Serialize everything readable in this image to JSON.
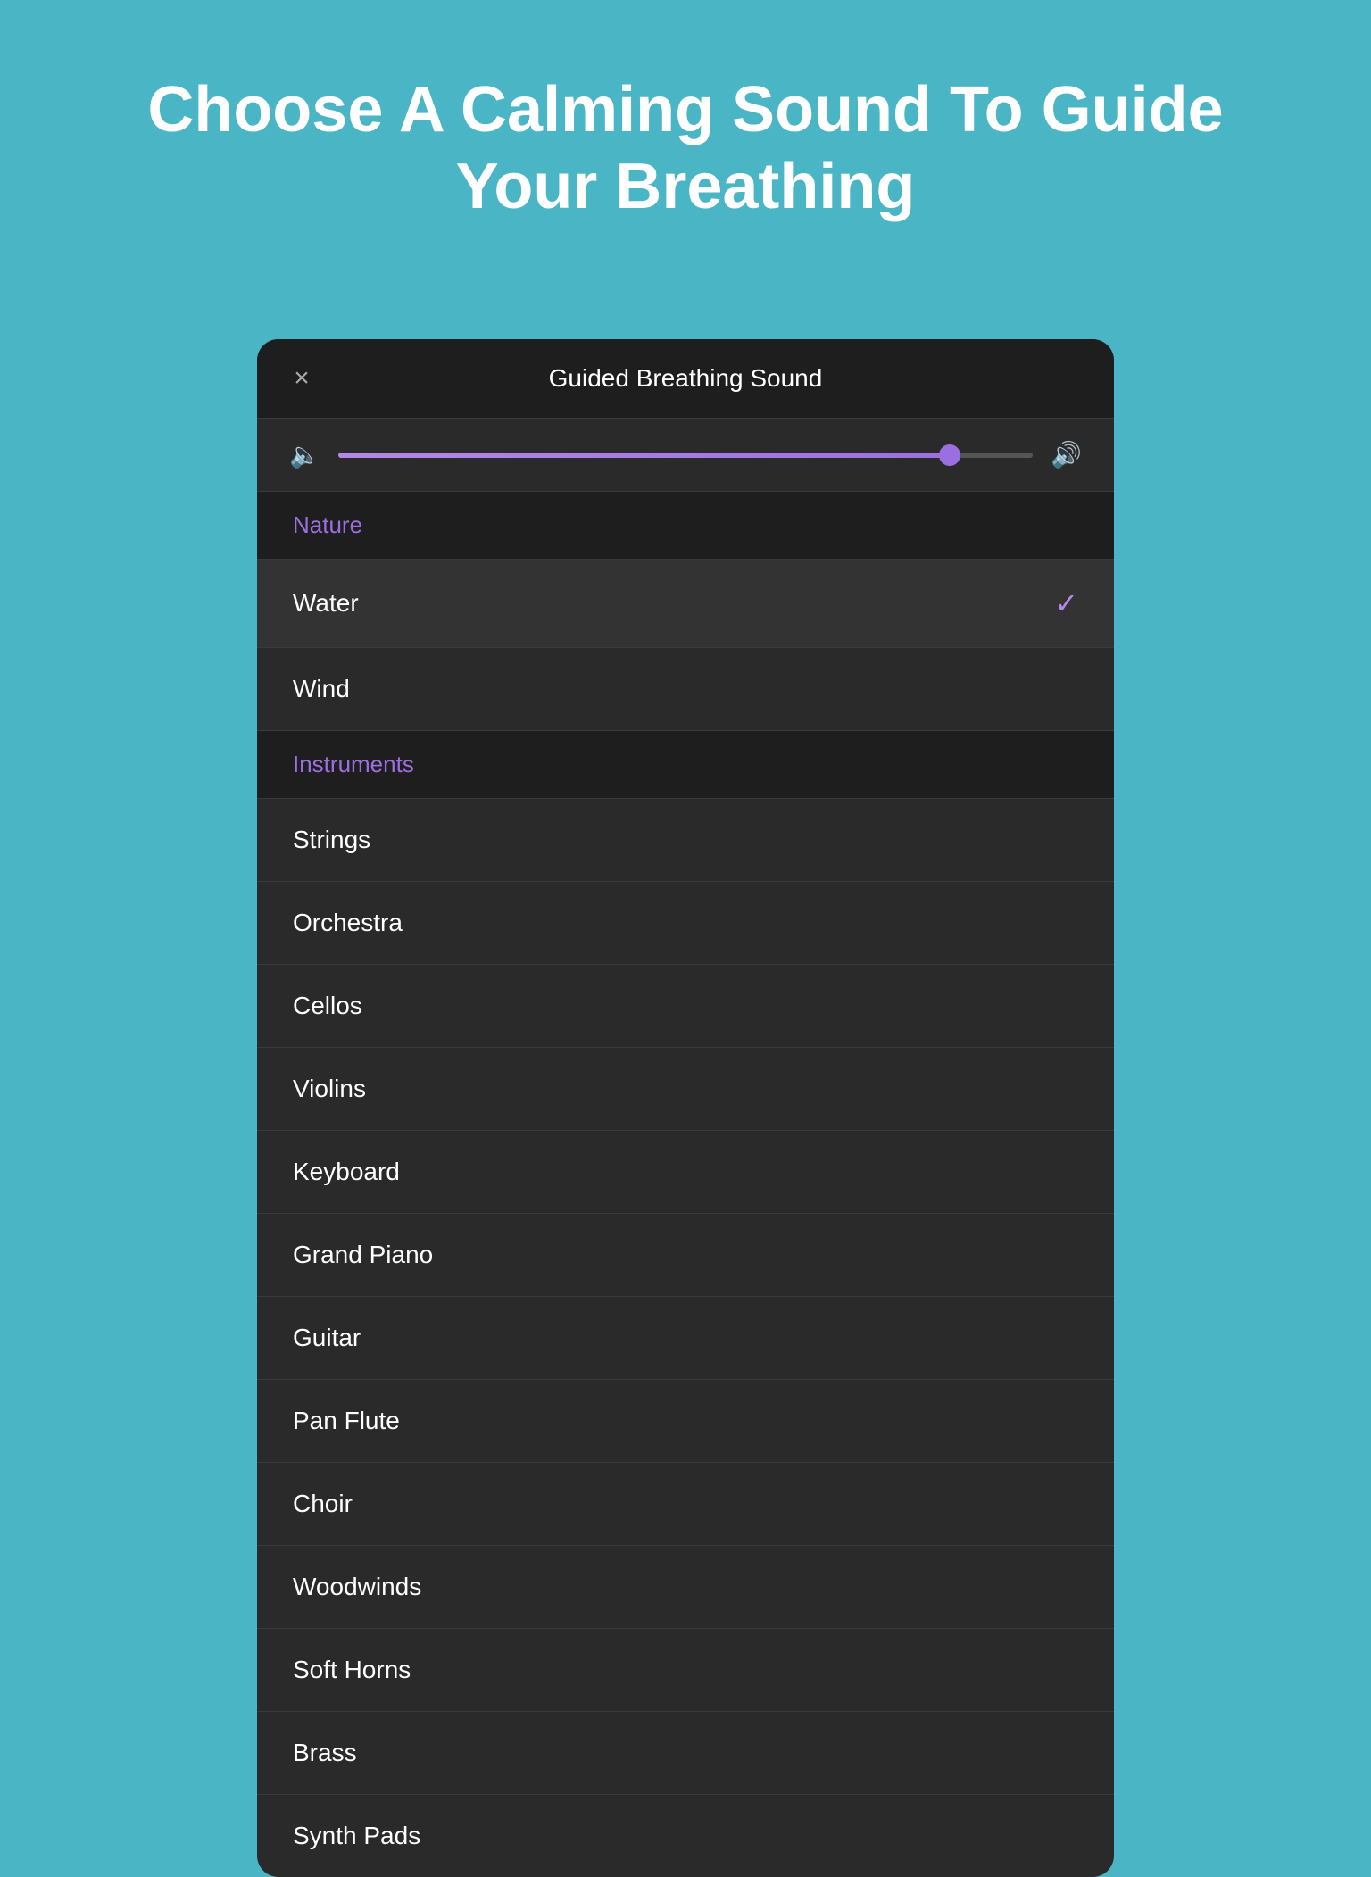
{
  "page": {
    "title": "Choose A Calming Sound To Guide Your Breathing",
    "background_color": "#4ab5c4"
  },
  "modal": {
    "title": "Guided Breathing Sound",
    "close_label": "×",
    "volume": {
      "min_icon": "🔈",
      "max_icon": "🔊",
      "value": 88,
      "fill_percent": "88%"
    },
    "sound_list": [
      {
        "id": "nature",
        "label": "Nature",
        "type": "category",
        "selected": false
      },
      {
        "id": "water",
        "label": "Water",
        "type": "item",
        "selected": true
      },
      {
        "id": "wind",
        "label": "Wind",
        "type": "item",
        "selected": false
      },
      {
        "id": "instruments",
        "label": "Instruments",
        "type": "category",
        "selected": false
      },
      {
        "id": "strings",
        "label": "Strings",
        "type": "item",
        "selected": false
      },
      {
        "id": "orchestra",
        "label": "Orchestra",
        "type": "item",
        "selected": false
      },
      {
        "id": "cellos",
        "label": "Cellos",
        "type": "item",
        "selected": false
      },
      {
        "id": "violins",
        "label": "Violins",
        "type": "item",
        "selected": false
      },
      {
        "id": "keyboard",
        "label": "Keyboard",
        "type": "item",
        "selected": false
      },
      {
        "id": "grand-piano",
        "label": "Grand Piano",
        "type": "item",
        "selected": false
      },
      {
        "id": "guitar",
        "label": "Guitar",
        "type": "item",
        "selected": false
      },
      {
        "id": "pan-flute",
        "label": "Pan Flute",
        "type": "item",
        "selected": false
      },
      {
        "id": "choir",
        "label": "Choir",
        "type": "item",
        "selected": false
      },
      {
        "id": "woodwinds",
        "label": "Woodwinds",
        "type": "item",
        "selected": false
      },
      {
        "id": "soft-horns",
        "label": "Soft Horns",
        "type": "item",
        "selected": false
      },
      {
        "id": "brass",
        "label": "Brass",
        "type": "item",
        "selected": false
      },
      {
        "id": "synth-pads",
        "label": "Synth Pads",
        "type": "item",
        "selected": false
      }
    ],
    "checkmark_symbol": "✓"
  }
}
